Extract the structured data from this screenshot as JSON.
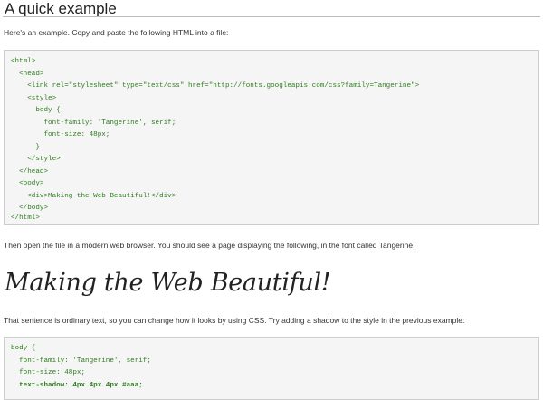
{
  "section": {
    "heading": "A quick example",
    "intro": "Here's an example. Copy and paste the following HTML into a file:",
    "code_block_1": [
      "<html>",
      "  <head>",
      "    <link rel=\"stylesheet\" type=\"text/css\" href=\"http://fonts.googleapis.com/css?family=Tangerine\">",
      "    <style>",
      "      body {",
      "        font-family: 'Tangerine', serif;",
      "        font-size: 48px;",
      "      }",
      "    </style>",
      "  </head>",
      "  <body>",
      "    <div>Making the Web Beautiful!</div>",
      "  </body>",
      "</html>"
    ],
    "after_code": "Then open the file in a modern web browser. You should see a page displaying the following, in the font called Tangerine:",
    "demo_text": "Making the Web Beautiful!",
    "after_demo": "That sentence is ordinary text, so you can change how it looks by using CSS. Try adding a shadow to the style in the previous example:",
    "code_block_2": [
      "body {",
      "  font-family: 'Tangerine', serif;",
      "  font-size: 48px;",
      "  text-shadow: 4px 4px 4px #aaa;"
    ]
  },
  "colors": {
    "code_text": "#2e7d1e",
    "code_background": "#f5f5f5",
    "code_border": "#cccccc"
  }
}
